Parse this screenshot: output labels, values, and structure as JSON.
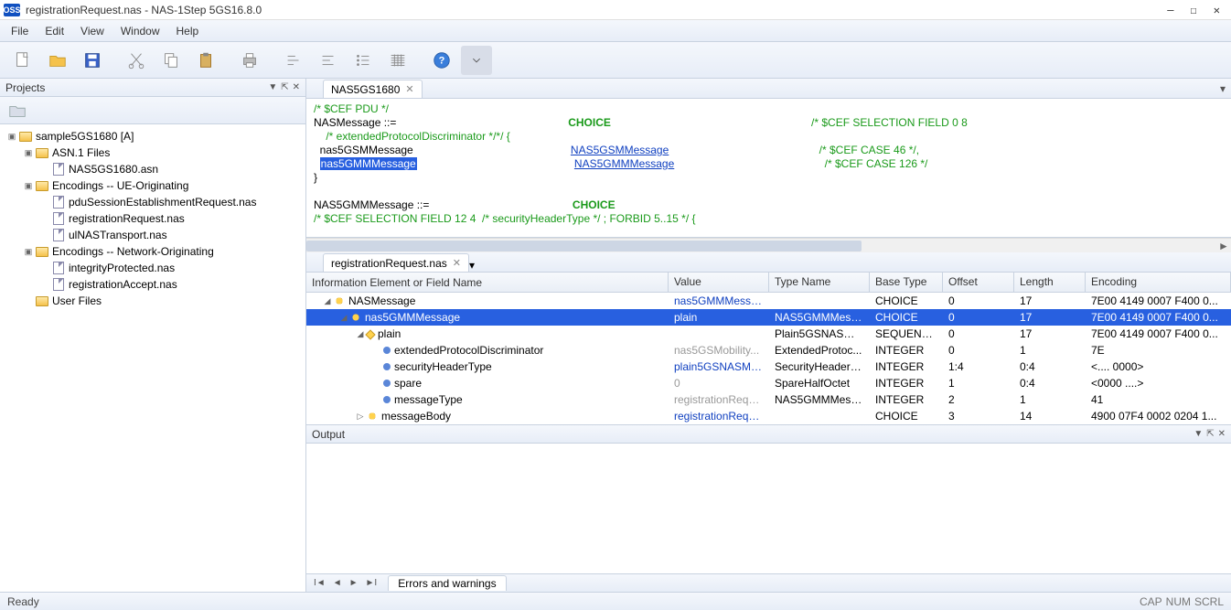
{
  "title": "registrationRequest.nas - NAS-1Step 5GS16.8.0",
  "logo": "OSS",
  "menu": [
    "File",
    "Edit",
    "View",
    "Window",
    "Help"
  ],
  "projects": {
    "title": "Projects",
    "tree": [
      {
        "d": 0,
        "tw": "▣",
        "icon": "folder",
        "label": "sample5GS1680 [A]"
      },
      {
        "d": 1,
        "tw": "▣",
        "icon": "folder",
        "label": "ASN.1 Files"
      },
      {
        "d": 2,
        "tw": "",
        "icon": "file",
        "label": "NAS5GS1680.asn"
      },
      {
        "d": 1,
        "tw": "▣",
        "icon": "folder",
        "label": "Encodings -- UE-Originating"
      },
      {
        "d": 2,
        "tw": "",
        "icon": "file",
        "label": "pduSessionEstablishmentRequest.nas"
      },
      {
        "d": 2,
        "tw": "",
        "icon": "file",
        "label": "registrationRequest.nas"
      },
      {
        "d": 2,
        "tw": "",
        "icon": "file",
        "label": "ulNASTransport.nas"
      },
      {
        "d": 1,
        "tw": "▣",
        "icon": "folder",
        "label": "Encodings -- Network-Originating"
      },
      {
        "d": 2,
        "tw": "",
        "icon": "file",
        "label": "integrityProtected.nas"
      },
      {
        "d": 2,
        "tw": "",
        "icon": "file",
        "label": "registrationAccept.nas"
      },
      {
        "d": 1,
        "tw": "",
        "icon": "folder",
        "label": "User Files"
      }
    ]
  },
  "editor_tab": "NAS5GS1680",
  "grid_tab": "registrationRequest.nas",
  "code": {
    "l1": "/* $CEF PDU */",
    "l2a": "NASMessage ::=",
    "l2b": "CHOICE",
    "l2c": "/* $CEF SELECTION FIELD 0 8",
    "l3": "    /* extendedProtocolDiscriminator */*/ {",
    "l4a": "  nas5GSMMessage",
    "l4b": "NAS5GSMMessage",
    "l4c": "/* $CEF CASE 46 */,",
    "l5a": "  ",
    "l5sel": "nas5GMMMessage",
    "l5b": "NAS5GMMMessage",
    "l5c": "/* $CEF CASE 126 */",
    "l6": "}",
    "l7": "",
    "l8a": "NAS5GMMMessage ::=",
    "l8b": "CHOICE",
    "l9": "/* $CEF SELECTION FIELD 12 4  /* securityHeaderType */ ; FORBID 5..15 */ {"
  },
  "grid": {
    "headers": [
      "Information Element or Field Name",
      "Value",
      "Type Name",
      "Base Type",
      "Offset",
      "Length",
      "Encoding"
    ],
    "rows": [
      {
        "d": 0,
        "tw": "◢",
        "ic": "choice",
        "name": "NASMessage",
        "val": "nas5GMMMessa...",
        "vcls": "vblue",
        "type": "",
        "base": "CHOICE",
        "off": "0",
        "len": "17",
        "enc": "7E00 4149 0007 F400 0...",
        "sel": false
      },
      {
        "d": 1,
        "tw": "◢",
        "ic": "choice",
        "name": "nas5GMMMessage",
        "val": "plain",
        "vcls": "vblue",
        "type": "NAS5GMMMess...",
        "base": "CHOICE",
        "off": "0",
        "len": "17",
        "enc": "7E00 4149 0007 F400 0...",
        "sel": true
      },
      {
        "d": 2,
        "tw": "◢",
        "ic": "seq",
        "name": "plain",
        "val": "",
        "vcls": "",
        "type": "Plain5GSNASMe...",
        "base": "SEQUENCE",
        "off": "0",
        "len": "17",
        "enc": "7E00 4149 0007 F400 0...",
        "sel": false
      },
      {
        "d": 3,
        "tw": "",
        "ic": "leaf",
        "name": "extendedProtocolDiscriminator",
        "val": "nas5GSMobility...",
        "vcls": "vgray",
        "type": "ExtendedProtoc...",
        "base": "INTEGER",
        "off": "0",
        "len": "1",
        "enc": "7E",
        "sel": false
      },
      {
        "d": 3,
        "tw": "",
        "ic": "leaf",
        "name": "securityHeaderType",
        "val": "plain5GSNASMe...",
        "vcls": "vblue",
        "type": "SecurityHeaderT...",
        "base": "INTEGER",
        "off": "1:4",
        "len": "0:4",
        "enc": "<.... 0000>",
        "sel": false
      },
      {
        "d": 3,
        "tw": "",
        "ic": "leaf",
        "name": "spare",
        "val": "0",
        "vcls": "vgray",
        "type": "SpareHalfOctet",
        "base": "INTEGER",
        "off": "1",
        "len": "0:4",
        "enc": "<0000 ....>",
        "sel": false
      },
      {
        "d": 3,
        "tw": "",
        "ic": "leaf",
        "name": "messageType",
        "val": "registrationRequ...",
        "vcls": "vgray",
        "type": "NAS5GMMMess...",
        "base": "INTEGER",
        "off": "2",
        "len": "1",
        "enc": "41",
        "sel": false
      },
      {
        "d": 2,
        "tw": "▷",
        "ic": "choice",
        "name": "messageBody",
        "val": "registrationRequ...",
        "vcls": "vblue",
        "type": "",
        "base": "CHOICE",
        "off": "3",
        "len": "14",
        "enc": "4900 07F4 0002 0204 1...",
        "sel": false
      }
    ]
  },
  "output_title": "Output",
  "output_tab": "Errors and warnings",
  "status": {
    "ready": "Ready",
    "cap": "CAP",
    "num": "NUM",
    "scrl": "SCRL"
  }
}
